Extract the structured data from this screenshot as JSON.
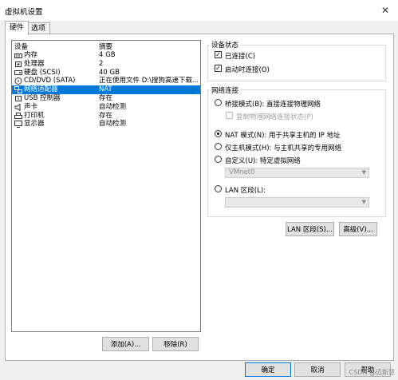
{
  "window": {
    "title": "虚拟机设置",
    "close_glyph": "✕"
  },
  "tabs": [
    {
      "label": "硬件"
    },
    {
      "label": "选项"
    }
  ],
  "device_list": {
    "col_device": "设备",
    "col_summary": "摘要",
    "rows": [
      {
        "name": "内存",
        "summary": "4 GB",
        "icon": "memory-icon"
      },
      {
        "name": "处理器",
        "summary": "2",
        "icon": "processor-icon"
      },
      {
        "name": "硬盘 (SCSI)",
        "summary": "40 GB",
        "icon": "hard-disk-icon"
      },
      {
        "name": "CD/DVD (SATA)",
        "summary": "正在使用文件 D:\\搜狗高速下载...",
        "icon": "cd-dvd-icon"
      },
      {
        "name": "网络适配器",
        "summary": "NAT",
        "icon": "network-adapter-icon",
        "selected": true
      },
      {
        "name": "USB 控制器",
        "summary": "存在",
        "icon": "usb-icon"
      },
      {
        "name": "声卡",
        "summary": "自动检测",
        "icon": "sound-card-icon"
      },
      {
        "name": "打印机",
        "summary": "存在",
        "icon": "printer-icon"
      },
      {
        "name": "显示器",
        "summary": "自动检测",
        "icon": "display-icon"
      }
    ]
  },
  "list_buttons": {
    "add": "添加(A)...",
    "remove": "移除(R)"
  },
  "device_status": {
    "label": "设备状态",
    "connected": {
      "label": "已连接(C)",
      "checked": true
    },
    "connect_on_power": {
      "label": "启动时连接(O)",
      "checked": true
    }
  },
  "network": {
    "label": "网络连接",
    "bridged": {
      "label": "桥接模式(B): 直接连接物理网络",
      "selected": false
    },
    "replicate": {
      "label": "复制物理网络连接状态(P)",
      "checked": false
    },
    "nat": {
      "label": "NAT 模式(N): 用于共享主机的 IP 地址",
      "selected": true
    },
    "host_only": {
      "label": "仅主机模式(H): 与主机共享的专用网络",
      "selected": false
    },
    "custom": {
      "label": "自定义(U): 特定虚拟网络",
      "selected": false
    },
    "custom_value": "VMnet0",
    "lan": {
      "label": "LAN 区段(L):",
      "selected": false
    },
    "lan_value": ""
  },
  "network_buttons": {
    "lan_segments": "LAN 区段(S)...",
    "advanced": "高级(V)..."
  },
  "dialog_buttons": {
    "ok": "确定",
    "cancel": "取消",
    "help": "帮助"
  },
  "watermark": "CSDN @迈斯慧"
}
